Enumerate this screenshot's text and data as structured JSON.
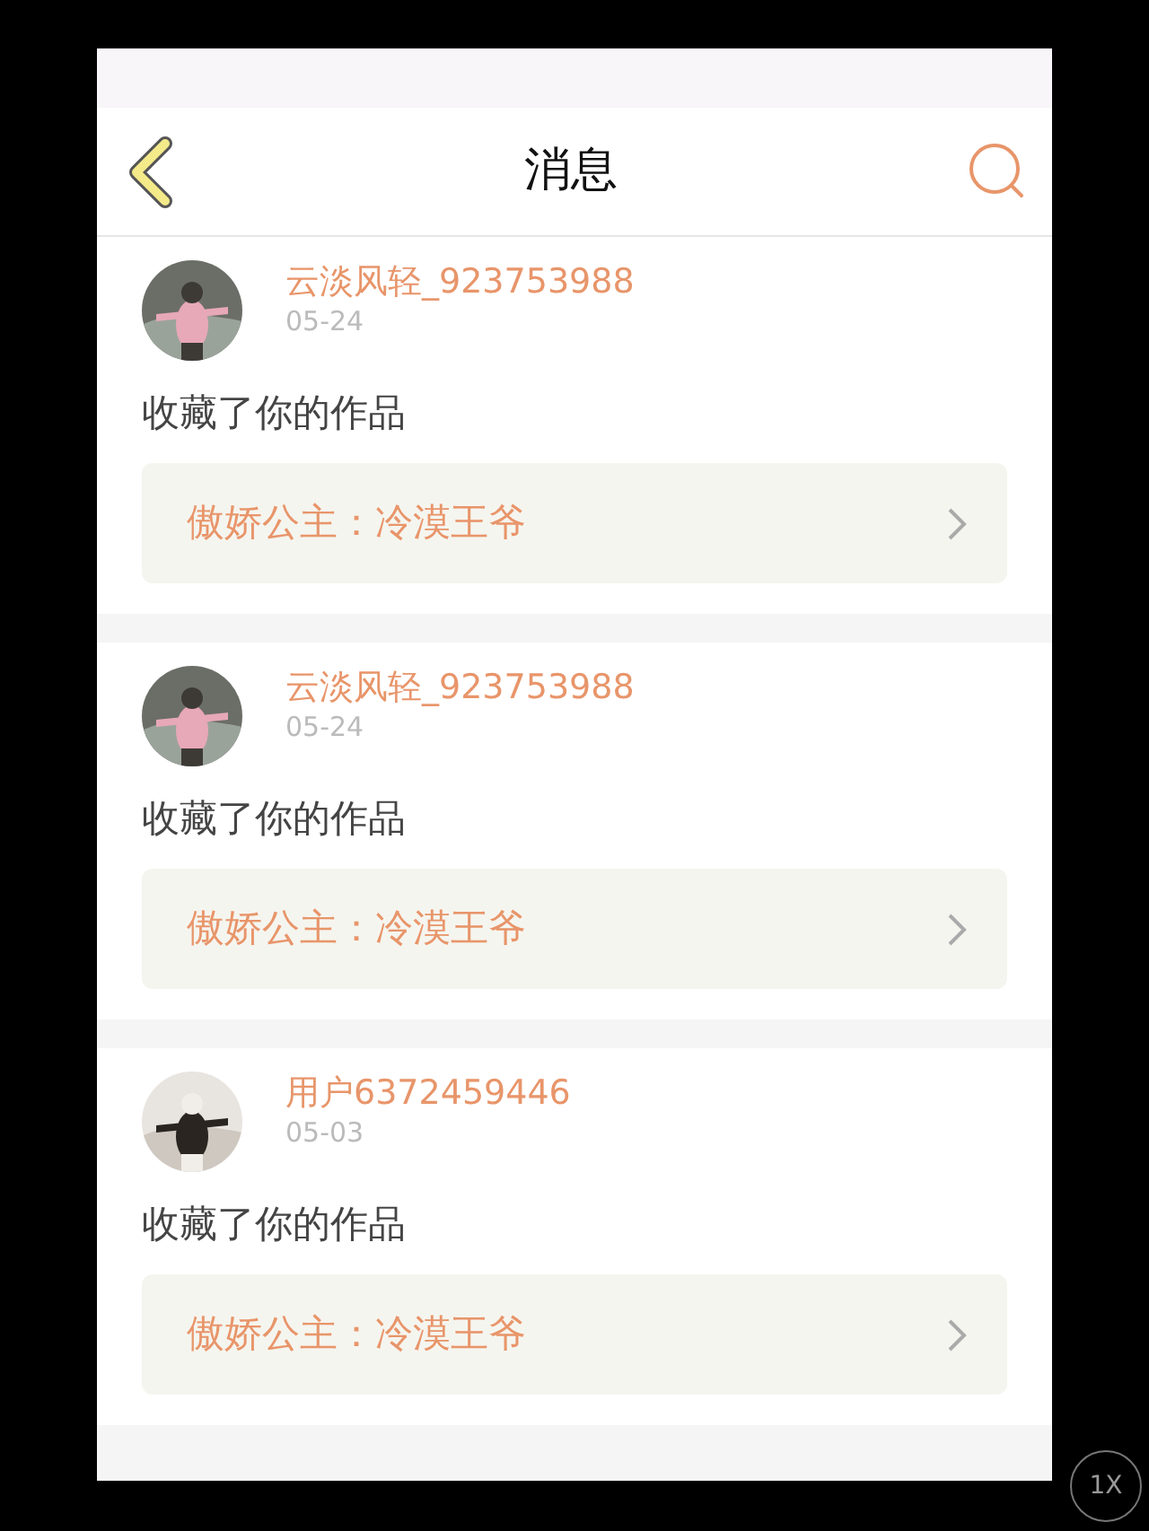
{
  "header": {
    "title": "消息"
  },
  "messages": [
    {
      "user": "云淡风轻_923753988",
      "date": "05-24",
      "action": "收藏了你的作品",
      "work": "傲娇公主：冷漠王爷"
    },
    {
      "user": "云淡风轻_923753988",
      "date": "05-24",
      "action": "收藏了你的作品",
      "work": "傲娇公主：冷漠王爷"
    },
    {
      "user": "用户6372459446",
      "date": "05-03",
      "action": "收藏了你的作品",
      "work": "傲娇公主：冷漠王爷"
    }
  ],
  "zoom_button": "1X"
}
